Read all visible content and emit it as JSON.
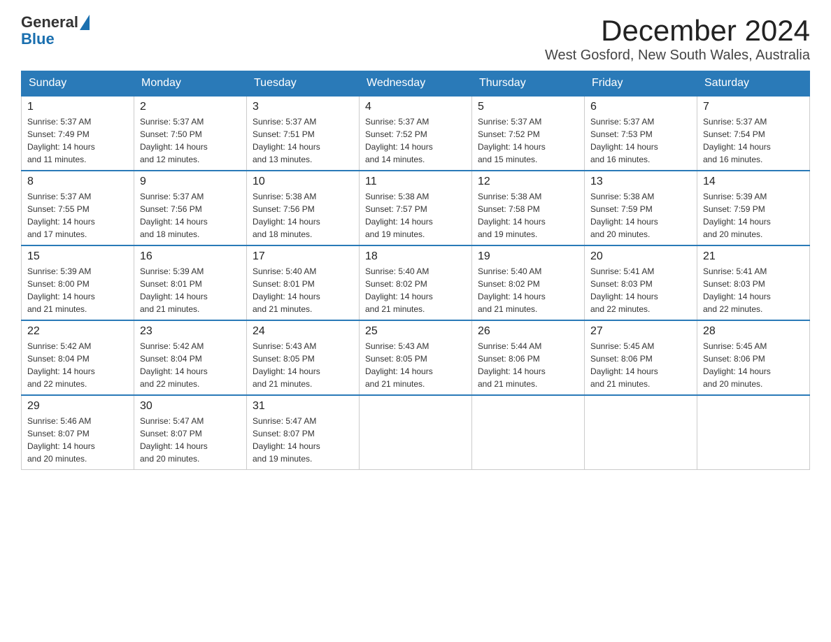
{
  "header": {
    "logo_general": "General",
    "logo_blue": "Blue",
    "title": "December 2024",
    "subtitle": "West Gosford, New South Wales, Australia"
  },
  "days_of_week": [
    "Sunday",
    "Monday",
    "Tuesday",
    "Wednesday",
    "Thursday",
    "Friday",
    "Saturday"
  ],
  "weeks": [
    [
      {
        "day": "1",
        "info": "Sunrise: 5:37 AM\nSunset: 7:49 PM\nDaylight: 14 hours\nand 11 minutes."
      },
      {
        "day": "2",
        "info": "Sunrise: 5:37 AM\nSunset: 7:50 PM\nDaylight: 14 hours\nand 12 minutes."
      },
      {
        "day": "3",
        "info": "Sunrise: 5:37 AM\nSunset: 7:51 PM\nDaylight: 14 hours\nand 13 minutes."
      },
      {
        "day": "4",
        "info": "Sunrise: 5:37 AM\nSunset: 7:52 PM\nDaylight: 14 hours\nand 14 minutes."
      },
      {
        "day": "5",
        "info": "Sunrise: 5:37 AM\nSunset: 7:52 PM\nDaylight: 14 hours\nand 15 minutes."
      },
      {
        "day": "6",
        "info": "Sunrise: 5:37 AM\nSunset: 7:53 PM\nDaylight: 14 hours\nand 16 minutes."
      },
      {
        "day": "7",
        "info": "Sunrise: 5:37 AM\nSunset: 7:54 PM\nDaylight: 14 hours\nand 16 minutes."
      }
    ],
    [
      {
        "day": "8",
        "info": "Sunrise: 5:37 AM\nSunset: 7:55 PM\nDaylight: 14 hours\nand 17 minutes."
      },
      {
        "day": "9",
        "info": "Sunrise: 5:37 AM\nSunset: 7:56 PM\nDaylight: 14 hours\nand 18 minutes."
      },
      {
        "day": "10",
        "info": "Sunrise: 5:38 AM\nSunset: 7:56 PM\nDaylight: 14 hours\nand 18 minutes."
      },
      {
        "day": "11",
        "info": "Sunrise: 5:38 AM\nSunset: 7:57 PM\nDaylight: 14 hours\nand 19 minutes."
      },
      {
        "day": "12",
        "info": "Sunrise: 5:38 AM\nSunset: 7:58 PM\nDaylight: 14 hours\nand 19 minutes."
      },
      {
        "day": "13",
        "info": "Sunrise: 5:38 AM\nSunset: 7:59 PM\nDaylight: 14 hours\nand 20 minutes."
      },
      {
        "day": "14",
        "info": "Sunrise: 5:39 AM\nSunset: 7:59 PM\nDaylight: 14 hours\nand 20 minutes."
      }
    ],
    [
      {
        "day": "15",
        "info": "Sunrise: 5:39 AM\nSunset: 8:00 PM\nDaylight: 14 hours\nand 21 minutes."
      },
      {
        "day": "16",
        "info": "Sunrise: 5:39 AM\nSunset: 8:01 PM\nDaylight: 14 hours\nand 21 minutes."
      },
      {
        "day": "17",
        "info": "Sunrise: 5:40 AM\nSunset: 8:01 PM\nDaylight: 14 hours\nand 21 minutes."
      },
      {
        "day": "18",
        "info": "Sunrise: 5:40 AM\nSunset: 8:02 PM\nDaylight: 14 hours\nand 21 minutes."
      },
      {
        "day": "19",
        "info": "Sunrise: 5:40 AM\nSunset: 8:02 PM\nDaylight: 14 hours\nand 21 minutes."
      },
      {
        "day": "20",
        "info": "Sunrise: 5:41 AM\nSunset: 8:03 PM\nDaylight: 14 hours\nand 22 minutes."
      },
      {
        "day": "21",
        "info": "Sunrise: 5:41 AM\nSunset: 8:03 PM\nDaylight: 14 hours\nand 22 minutes."
      }
    ],
    [
      {
        "day": "22",
        "info": "Sunrise: 5:42 AM\nSunset: 8:04 PM\nDaylight: 14 hours\nand 22 minutes."
      },
      {
        "day": "23",
        "info": "Sunrise: 5:42 AM\nSunset: 8:04 PM\nDaylight: 14 hours\nand 22 minutes."
      },
      {
        "day": "24",
        "info": "Sunrise: 5:43 AM\nSunset: 8:05 PM\nDaylight: 14 hours\nand 21 minutes."
      },
      {
        "day": "25",
        "info": "Sunrise: 5:43 AM\nSunset: 8:05 PM\nDaylight: 14 hours\nand 21 minutes."
      },
      {
        "day": "26",
        "info": "Sunrise: 5:44 AM\nSunset: 8:06 PM\nDaylight: 14 hours\nand 21 minutes."
      },
      {
        "day": "27",
        "info": "Sunrise: 5:45 AM\nSunset: 8:06 PM\nDaylight: 14 hours\nand 21 minutes."
      },
      {
        "day": "28",
        "info": "Sunrise: 5:45 AM\nSunset: 8:06 PM\nDaylight: 14 hours\nand 20 minutes."
      }
    ],
    [
      {
        "day": "29",
        "info": "Sunrise: 5:46 AM\nSunset: 8:07 PM\nDaylight: 14 hours\nand 20 minutes."
      },
      {
        "day": "30",
        "info": "Sunrise: 5:47 AM\nSunset: 8:07 PM\nDaylight: 14 hours\nand 20 minutes."
      },
      {
        "day": "31",
        "info": "Sunrise: 5:47 AM\nSunset: 8:07 PM\nDaylight: 14 hours\nand 19 minutes."
      },
      {
        "day": "",
        "info": ""
      },
      {
        "day": "",
        "info": ""
      },
      {
        "day": "",
        "info": ""
      },
      {
        "day": "",
        "info": ""
      }
    ]
  ]
}
